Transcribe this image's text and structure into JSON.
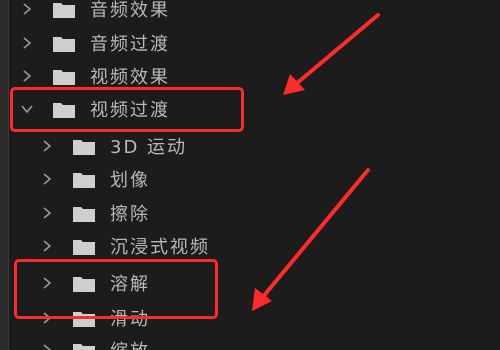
{
  "tree": {
    "top_level": [
      {
        "label": "音频效果",
        "expanded": false
      },
      {
        "label": "音频过渡",
        "expanded": false
      },
      {
        "label": "视频效果",
        "expanded": false
      },
      {
        "label": "视频过渡",
        "expanded": true
      }
    ],
    "children": [
      {
        "label": "3D 运动"
      },
      {
        "label": "划像"
      },
      {
        "label": "擦除"
      },
      {
        "label": "沉浸式视频"
      },
      {
        "label": "溶解"
      },
      {
        "label": "滑动"
      },
      {
        "label": "缩放"
      }
    ]
  },
  "annotation": {
    "color": "#ff2a2a",
    "highlighted_items": [
      "视频过渡",
      "溶解"
    ]
  },
  "icons": {
    "collapsed": "chevron-right-icon",
    "expanded": "chevron-down-icon",
    "folder": "folder-icon"
  }
}
